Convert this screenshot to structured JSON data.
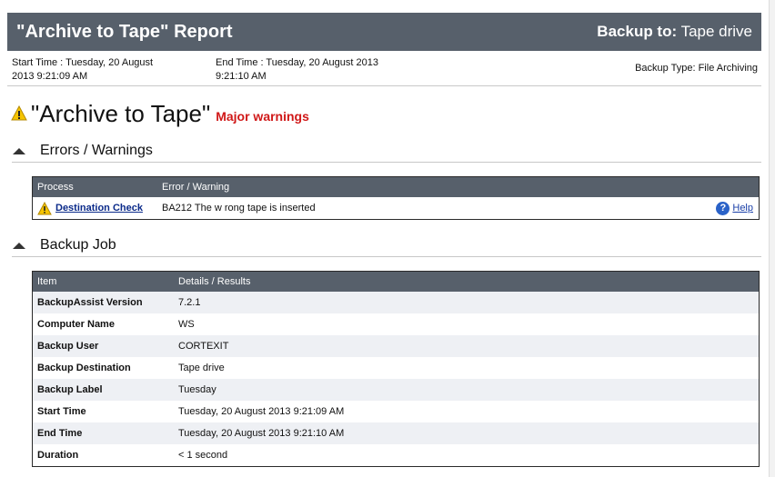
{
  "header": {
    "title": "\"Archive to Tape\" Report",
    "backup_to_label": "Backup to:",
    "backup_to_value": "Tape drive"
  },
  "meta": {
    "start": "Start Time :  Tuesday, 20 August 2013 9:21:09 AM",
    "end": "End Time :  Tuesday, 20 August 2013 9:21:10 AM",
    "type": "Backup Type: File Archiving"
  },
  "report": {
    "title": "\"Archive to Tape\"",
    "status": "Major warnings",
    "status_color": "#d01818"
  },
  "errors_section": {
    "title": "Errors / Warnings",
    "columns": [
      "Process",
      "Error  /  Warning"
    ],
    "rows": [
      {
        "process": "Destination Check",
        "message": "BA212 The w rong tape is inserted",
        "help": "Help"
      }
    ]
  },
  "backup_section": {
    "title": "Backup Job",
    "columns": [
      "Item",
      "Details  /  Results"
    ],
    "rows": [
      {
        "item": "BackupAssist Version",
        "value": "7.2.1"
      },
      {
        "item": "Computer Name",
        "value": "WS"
      },
      {
        "item": "Backup User",
        "value": "CORTEXIT"
      },
      {
        "item": "Backup Destination",
        "value": "Tape drive"
      },
      {
        "item": "Backup Label",
        "value": "Tuesday"
      },
      {
        "item": "Start Time",
        "value": "Tuesday, 20 August 2013 9:21:09 AM"
      },
      {
        "item": "End Time",
        "value": "Tuesday, 20 August 2013 9:21:10 AM"
      },
      {
        "item": "Duration",
        "value": "< 1 second"
      }
    ]
  },
  "colors": {
    "header_bg": "#57606b",
    "row_alt": "#eef0f4",
    "warning_yellow": "#f5c400",
    "help_blue": "#2a62c8"
  },
  "icons": {
    "warning": "warning-icon",
    "collapse": "collapse-arrow-icon",
    "help": "help-icon"
  }
}
